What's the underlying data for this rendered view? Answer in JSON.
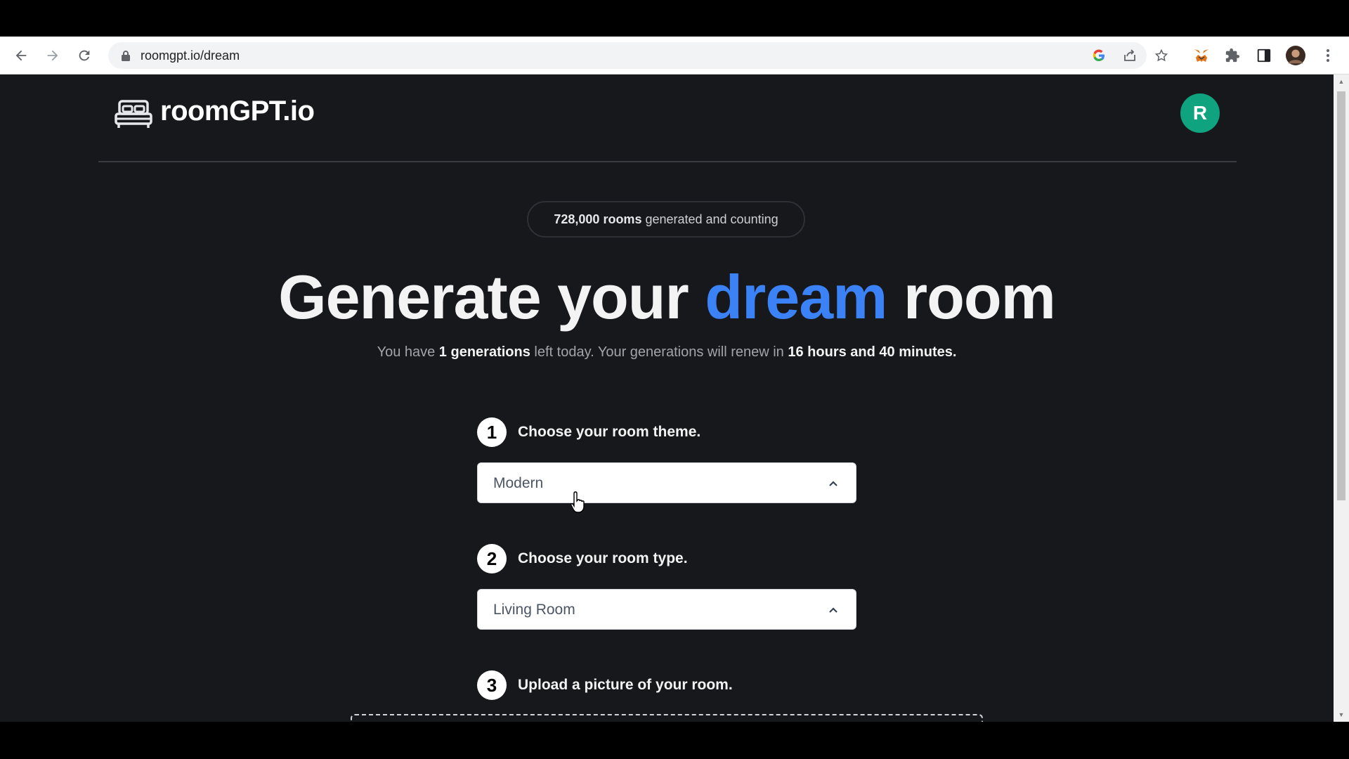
{
  "browser": {
    "url": "roomgpt.io/dream"
  },
  "header": {
    "brand": "roomGPT.io",
    "avatar_letter": "R"
  },
  "counter": {
    "count": "728,000 rooms",
    "suffix": "generated and counting"
  },
  "hero": {
    "title_part1": "Generate your ",
    "title_accent": "dream",
    "title_part2": " room",
    "sub_part1": "You have ",
    "sub_gens": "1 generations",
    "sub_part2": " left today. Your generations will renew in ",
    "sub_time": "16 hours and 40 minutes."
  },
  "steps": [
    {
      "num": "1",
      "label": "Choose your room theme.",
      "value": "Modern"
    },
    {
      "num": "2",
      "label": "Choose your room type.",
      "value": "Living Room"
    },
    {
      "num": "3",
      "label": "Upload a picture of your room."
    }
  ],
  "colors": {
    "accent": "#3b82f6",
    "avatar": "#10a37f",
    "page_bg": "#17181c"
  }
}
